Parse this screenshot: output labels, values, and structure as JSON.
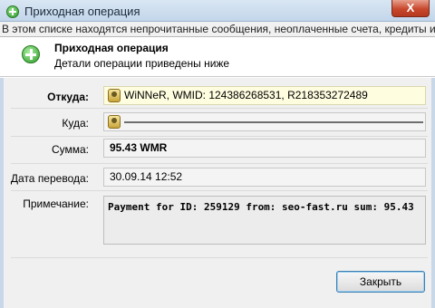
{
  "window": {
    "title": "Приходная операция",
    "close_label": "X",
    "icon": "green-plus-icon"
  },
  "notice": {
    "text": "В этом списке находятся непрочитанные сообщения, неоплаченные счета, кредиты и"
  },
  "header": {
    "title": "Приходная операция",
    "subtitle": "Детали операции приведены ниже",
    "icon": "green-plus-icon"
  },
  "form": {
    "from": {
      "label": "Откуда:",
      "value": "WiNNeR, WMID: 124386268531, R218353272489",
      "icon": "webmoney-passport-icon"
    },
    "to": {
      "label": "Куда:",
      "value": "",
      "icon": "webmoney-passport-icon"
    },
    "amount": {
      "label": "Сумма:",
      "value": "95.43 WMR"
    },
    "date": {
      "label": "Дата перевода:",
      "value": "30.09.14 12:52"
    },
    "note": {
      "label": "Примечание:",
      "value": "Payment for ID: 259129 from: seo-fast.ru sum: 95.43"
    }
  },
  "buttons": {
    "close": "Закрыть"
  }
}
